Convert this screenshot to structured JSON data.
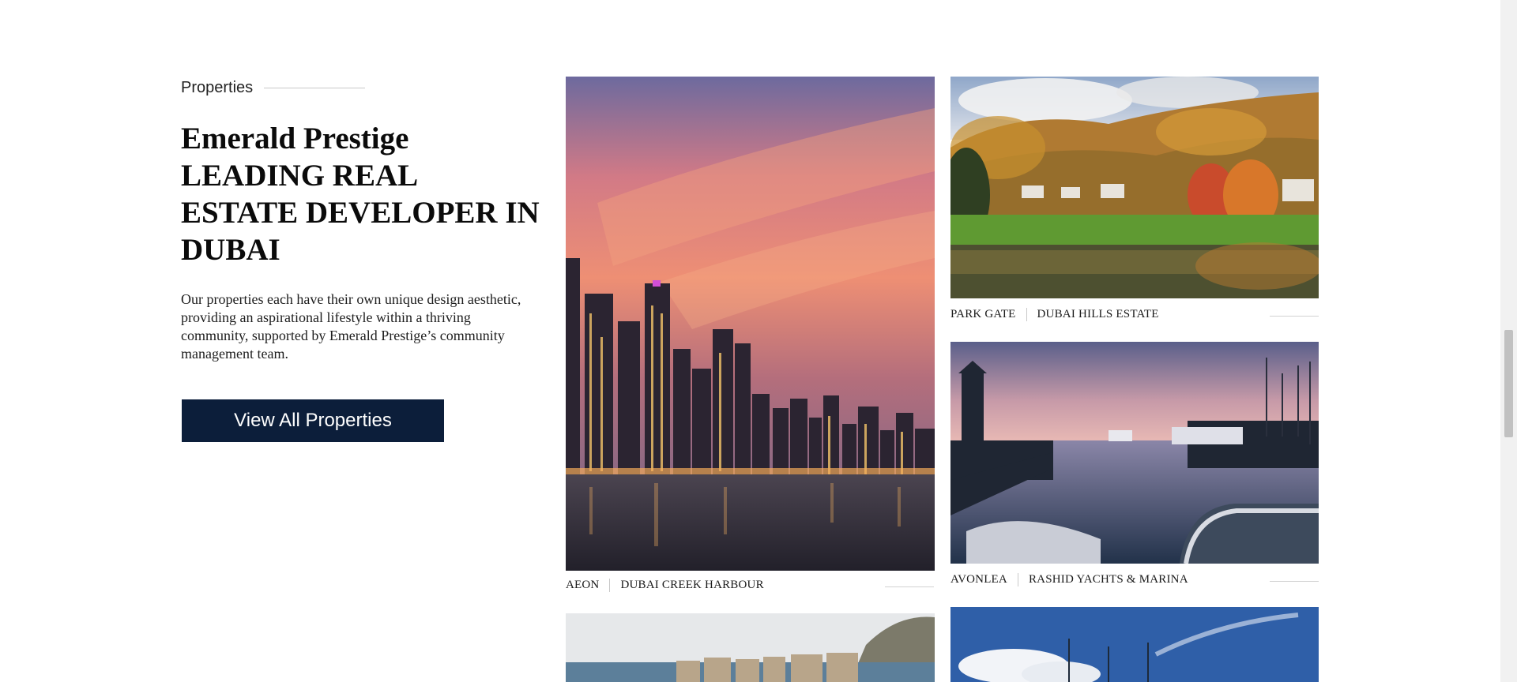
{
  "section": {
    "eyebrow": "Properties",
    "heading_lines": [
      "Emerald Prestige",
      "LEADING REAL",
      "ESTATE DEVELOPER IN",
      "DUBAI"
    ],
    "intro": "Our properties each have their own unique design aesthetic, providing an aspirational lifestyle within a thriving community, supported by Emerald Prestige’s community management team.",
    "cta_label": "View All Properties"
  },
  "properties": [
    {
      "name": "AEON",
      "location": "DUBAI CREEK HARBOUR"
    },
    {
      "name": "PARK GATE",
      "location": "DUBAI HILLS ESTATE"
    },
    {
      "name": "AVONLEA",
      "location": "RASHID YACHTS & MARINA"
    }
  ],
  "colors": {
    "cta_background": "#0c1e3a",
    "cta_text": "#ffffff"
  }
}
